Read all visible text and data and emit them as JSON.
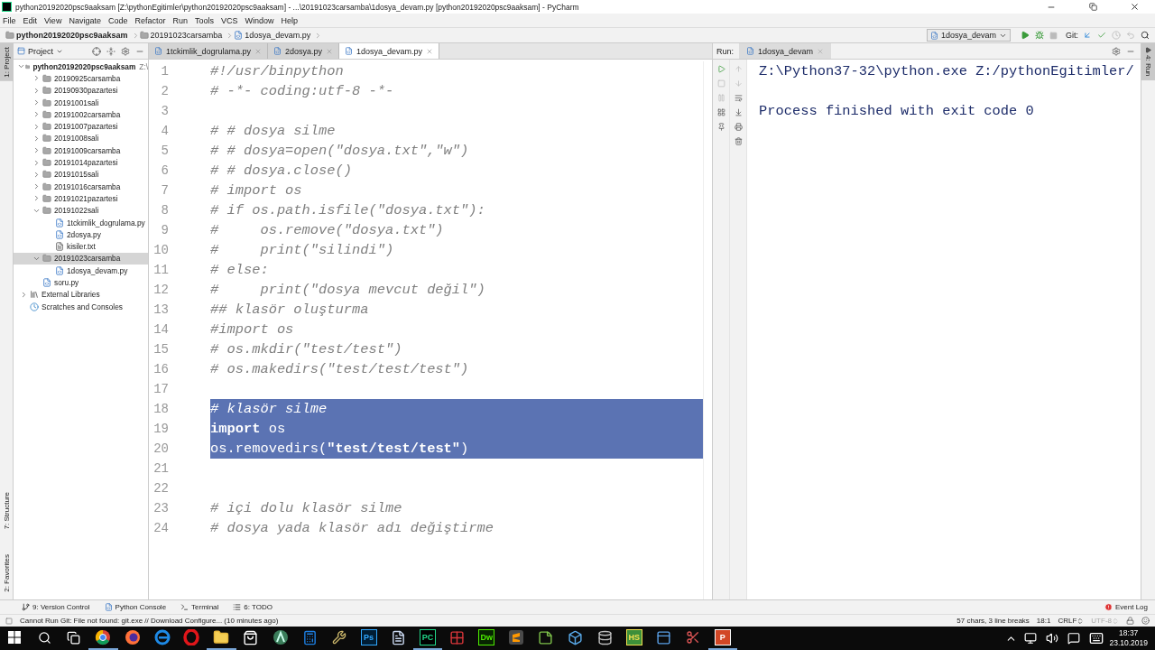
{
  "window": {
    "title": "python20192020psc9aaksam [Z:\\pythonEgitimler\\python20192020psc9aaksam] - ...\\20191023carsamba\\1dosya_devam.py [python20192020psc9aaksam] - PyCharm"
  },
  "menu": [
    "File",
    "Edit",
    "View",
    "Navigate",
    "Code",
    "Refactor",
    "Run",
    "Tools",
    "VCS",
    "Window",
    "Help"
  ],
  "breadcrumbs": [
    {
      "label": "python20192020psc9aaksam",
      "kind": "project"
    },
    {
      "label": "20191023carsamba",
      "kind": "folder"
    },
    {
      "label": "1dosya_devam.py",
      "kind": "python"
    }
  ],
  "run_config": {
    "label": "1dosya_devam"
  },
  "git_label": "Git:",
  "side_stripe": {
    "top": "1: Project",
    "middle": "7: Structure",
    "bottom": "2: Favorites",
    "right": "4: Run"
  },
  "project_panel": {
    "title": "Project",
    "tree": [
      {
        "label": "python20192020psc9aaksam",
        "hint": "Z:\\",
        "kind": "project",
        "expanded": true,
        "selected": false,
        "children": [
          {
            "label": "20190925carsamba",
            "kind": "folder",
            "expanded": false,
            "selected": false
          },
          {
            "label": "20190930pazartesi",
            "kind": "folder",
            "expanded": false,
            "selected": false
          },
          {
            "label": "20191001sali",
            "kind": "folder",
            "expanded": false,
            "selected": false
          },
          {
            "label": "20191002carsamba",
            "kind": "folder",
            "expanded": false,
            "selected": false
          },
          {
            "label": "20191007pazartesi",
            "kind": "folder",
            "expanded": false,
            "selected": false
          },
          {
            "label": "20191008sali",
            "kind": "folder",
            "expanded": false,
            "selected": false
          },
          {
            "label": "20191009carsamba",
            "kind": "folder",
            "expanded": false,
            "selected": false
          },
          {
            "label": "20191014pazartesi",
            "kind": "folder",
            "expanded": false,
            "selected": false
          },
          {
            "label": "20191015sali",
            "kind": "folder",
            "expanded": false,
            "selected": false
          },
          {
            "label": "20191016carsamba",
            "kind": "folder",
            "expanded": false,
            "selected": false
          },
          {
            "label": "20191021pazartesi",
            "kind": "folder",
            "expanded": false,
            "selected": false
          },
          {
            "label": "20191022sali",
            "kind": "folder",
            "expanded": true,
            "selected": false,
            "children": [
              {
                "label": "1tckimlik_dogrulama.py",
                "kind": "python",
                "selected": false
              },
              {
                "label": "2dosya.py",
                "kind": "python",
                "selected": false
              },
              {
                "label": "kisiler.txt",
                "kind": "text",
                "selected": false
              }
            ]
          },
          {
            "label": "20191023carsamba",
            "kind": "folder",
            "expanded": true,
            "selected": true,
            "children": [
              {
                "label": "1dosya_devam.py",
                "kind": "python",
                "selected": false
              }
            ]
          },
          {
            "label": "soru.py",
            "kind": "python",
            "selected": false
          }
        ]
      },
      {
        "label": "External Libraries",
        "kind": "library",
        "expanded": false,
        "selected": false
      },
      {
        "label": "Scratches and Consoles",
        "kind": "scratches",
        "selected": false
      }
    ]
  },
  "editor": {
    "tabs": [
      {
        "label": "1tckimlik_dogrulama.py",
        "selected": false
      },
      {
        "label": "2dosya.py",
        "selected": false
      },
      {
        "label": "1dosya_devam.py",
        "selected": true
      }
    ],
    "lines": [
      {
        "number": "1",
        "text": "#!/usr/binpython",
        "kind": "comment",
        "selected": false
      },
      {
        "number": "2",
        "text": "# -*- coding:utf-8 -*-",
        "kind": "comment",
        "selected": false
      },
      {
        "number": "3",
        "kind": "blank",
        "selected": false
      },
      {
        "number": "4",
        "text": "# # dosya silme",
        "kind": "comment",
        "selected": false
      },
      {
        "number": "5",
        "text": "# # dosya=open(\"dosya.txt\",\"w\")",
        "kind": "comment",
        "selected": false
      },
      {
        "number": "6",
        "text": "# # dosya.close()",
        "kind": "comment",
        "selected": false
      },
      {
        "number": "7",
        "text": "# import os",
        "kind": "comment",
        "selected": false
      },
      {
        "number": "8",
        "text": "# if os.path.isfile(\"dosya.txt\"):",
        "kind": "comment",
        "selected": false
      },
      {
        "number": "9",
        "text": "#     os.remove(\"dosya.txt\")",
        "kind": "comment",
        "selected": false
      },
      {
        "number": "10",
        "text": "#     print(\"silindi\")",
        "kind": "comment",
        "selected": false
      },
      {
        "number": "11",
        "text": "# else:",
        "kind": "comment",
        "selected": false
      },
      {
        "number": "12",
        "text": "#     print(\"dosya mevcut değil\")",
        "kind": "comment",
        "selected": false
      },
      {
        "number": "13",
        "text": "## klasör oluşturma",
        "kind": "comment",
        "selected": false
      },
      {
        "number": "14",
        "text": "#import os",
        "kind": "comment",
        "selected": false
      },
      {
        "number": "15",
        "text": "# os.mkdir(\"test/test\")",
        "kind": "comment",
        "selected": false
      },
      {
        "number": "16",
        "text": "# os.makedirs(\"test/test/test\")",
        "kind": "comment",
        "selected": false
      },
      {
        "number": "17",
        "kind": "blank",
        "selected": false
      },
      {
        "number": "18",
        "text": "# klasör silme",
        "kind": "comment",
        "selected": true
      },
      {
        "number": "19",
        "text": "**import** os",
        "kind": "code",
        "selected": true
      },
      {
        "number": "20",
        "text": "os.removedirs(**\"test/test/test\"**)",
        "kind": "code",
        "selected": true
      },
      {
        "number": "21",
        "kind": "blank",
        "selected": false
      },
      {
        "number": "22",
        "kind": "blank",
        "selected": false
      },
      {
        "number": "23",
        "text": "# içi dolu klasör silme",
        "kind": "comment",
        "selected": false
      },
      {
        "number": "24",
        "text": "# dosya yada klasör adı değiştirme",
        "kind": "comment",
        "selected": false
      }
    ]
  },
  "run_panel": {
    "label": "Run:",
    "tab": "1dosya_devam",
    "output": [
      "Z:\\Python37-32\\python.exe Z:/pythonEgitimler/",
      "Process finished with exit code 0"
    ]
  },
  "tool_windows": [
    {
      "label": "9: Version Control",
      "kind": "vcs"
    },
    {
      "label": "Python Console",
      "kind": "python"
    },
    {
      "label": "Terminal",
      "kind": "terminal"
    },
    {
      "label": "6: TODO",
      "kind": "todo"
    }
  ],
  "event_log": {
    "label": "Event Log"
  },
  "status_bar": {
    "message": "Cannot Run Git: File not found: git.exe // Download Configure... (10 minutes ago)",
    "items": [
      {
        "text": "57 chars, 3 line breaks",
        "kind": "plain",
        "disabled": false
      },
      {
        "text": "18:1",
        "kind": "plain",
        "disabled": false
      },
      {
        "text": "CRLF",
        "kind": "choice",
        "disabled": false
      },
      {
        "text": "UTF-8",
        "kind": "choice",
        "disabled": true
      }
    ]
  },
  "taskbar": {
    "apps": [
      {
        "kind": "chrome",
        "running": true
      },
      {
        "kind": "firefox",
        "running": false
      },
      {
        "kind": "edge",
        "running": false
      },
      {
        "kind": "opera",
        "running": false
      },
      {
        "kind": "explorer",
        "running": true
      },
      {
        "kind": "store",
        "running": false
      },
      {
        "kind": "android",
        "running": false
      },
      {
        "kind": "calculator",
        "running": false
      },
      {
        "kind": "tools",
        "running": false
      },
      {
        "kind": "letters",
        "label": "Ps",
        "running": false
      },
      {
        "kind": "document",
        "running": false
      },
      {
        "kind": "letters",
        "label": "PC",
        "running": true
      },
      {
        "kind": "tiles",
        "running": false
      },
      {
        "kind": "letters",
        "label": "Dw",
        "running": false
      },
      {
        "kind": "sublime",
        "running": false
      },
      {
        "kind": "notepad",
        "running": false
      },
      {
        "kind": "box",
        "running": false
      },
      {
        "kind": "database",
        "running": false
      },
      {
        "kind": "letters",
        "label": "HS",
        "running": false
      },
      {
        "kind": "notes",
        "running": false
      },
      {
        "kind": "scissors",
        "running": false
      },
      {
        "kind": "letters",
        "label": "P",
        "running": true
      }
    ],
    "time": "18:37",
    "date": "23.10.2019"
  }
}
